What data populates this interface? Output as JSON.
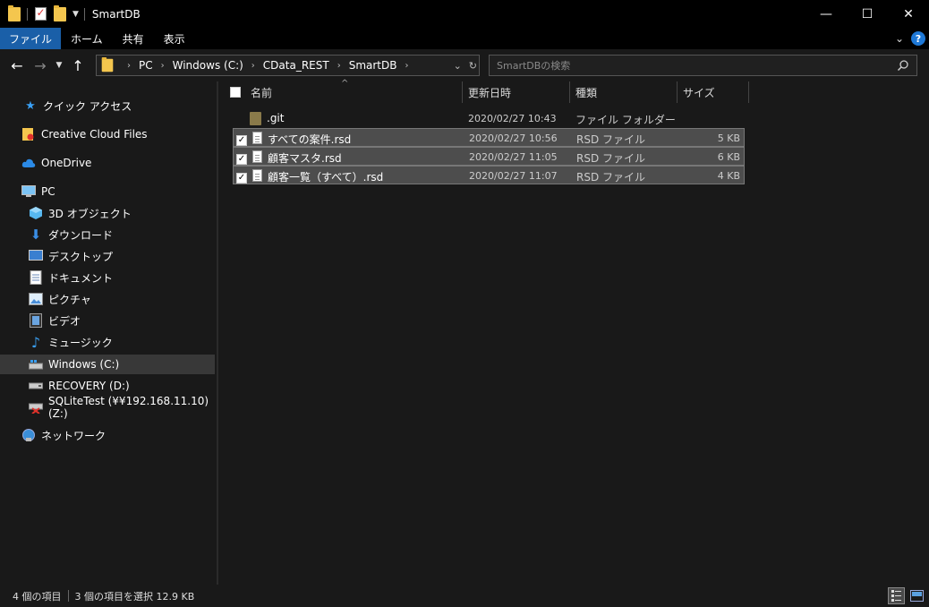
{
  "window": {
    "title": "SmartDB",
    "controls": {
      "minimize": "—",
      "maximize": "☐",
      "close": "✕"
    }
  },
  "ribbon": {
    "tabs": [
      "ファイル",
      "ホーム",
      "共有",
      "表示"
    ],
    "help": "?"
  },
  "nav": {
    "breadcrumb": [
      "PC",
      "Windows (C:)",
      "CData_REST",
      "SmartDB"
    ],
    "search_placeholder": "SmartDBの検索"
  },
  "sidebar": {
    "items": [
      {
        "label": "クイック アクセス",
        "icon": "star-icon"
      },
      {
        "label": "Creative Cloud Files",
        "icon": "creative-cloud-folder-icon"
      },
      {
        "label": "OneDrive",
        "icon": "cloud-icon"
      },
      {
        "label": "PC",
        "icon": "computer-icon"
      },
      {
        "label": "3D オブジェクト",
        "icon": "cube-icon"
      },
      {
        "label": "ダウンロード",
        "icon": "download-arrow-icon"
      },
      {
        "label": "デスクトップ",
        "icon": "desktop-icon"
      },
      {
        "label": "ドキュメント",
        "icon": "document-icon"
      },
      {
        "label": "ピクチャ",
        "icon": "picture-icon"
      },
      {
        "label": "ビデオ",
        "icon": "video-icon"
      },
      {
        "label": "ミュージック",
        "icon": "music-note-icon"
      },
      {
        "label": "Windows (C:)",
        "icon": "windows-drive-icon"
      },
      {
        "label": "RECOVERY (D:)",
        "icon": "drive-icon"
      },
      {
        "label": "SQLiteTest (¥¥192.168.11.10) (Z:)",
        "icon": "network-drive-disconnected-icon"
      },
      {
        "label": "ネットワーク",
        "icon": "network-icon"
      }
    ]
  },
  "columns": {
    "name": "名前",
    "date": "更新日時",
    "type": "種類",
    "size": "サイズ"
  },
  "files": [
    {
      "name": ".git",
      "date": "2020/02/27 10:43",
      "type": "ファイル フォルダー",
      "size": "",
      "selected": false
    },
    {
      "name": "すべての案件.rsd",
      "date": "2020/02/27 10:56",
      "type": "RSD ファイル",
      "size": "5 KB",
      "selected": true
    },
    {
      "name": "顧客マスタ.rsd",
      "date": "2020/02/27 11:05",
      "type": "RSD ファイル",
      "size": "6 KB",
      "selected": true
    },
    {
      "name": "顧客一覧（すべて）.rsd",
      "date": "2020/02/27 11:07",
      "type": "RSD ファイル",
      "size": "4 KB",
      "selected": true
    }
  ],
  "status": {
    "item_count": "4 個の項目",
    "selection": "3 個の項目を選択  12.9 KB"
  },
  "colors": {
    "accent": "#1a5fa8",
    "background": "#191919",
    "selection": "#4d4d4d"
  }
}
